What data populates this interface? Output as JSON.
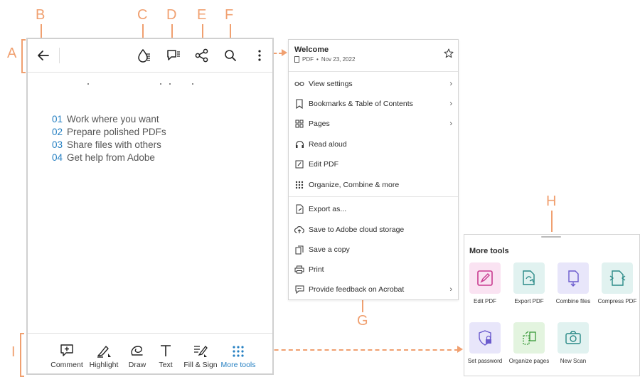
{
  "callouts": [
    "A",
    "B",
    "C",
    "D",
    "E",
    "F",
    "G",
    "H",
    "I"
  ],
  "toc": [
    {
      "num": "01",
      "text": "Work where you want"
    },
    {
      "num": "02",
      "text": "Prepare polished PDFs"
    },
    {
      "num": "03",
      "text": "Share files with others"
    },
    {
      "num": "04",
      "text": "Get help from Adobe"
    }
  ],
  "bottombar": [
    "Comment",
    "Highlight",
    "Draw",
    "Text",
    "Fill & Sign",
    "More tools"
  ],
  "menu": {
    "title": "Welcome",
    "meta_type": "PDF",
    "meta_dot": "•",
    "meta_date": "Nov 23, 2022",
    "items": [
      "View settings",
      "Bookmarks & Table of Contents",
      "Pages",
      "Read aloud",
      "Edit PDF",
      "Organize, Combine & more",
      "Export as...",
      "Save to Adobe cloud storage",
      "Save a copy",
      "Print",
      "Provide feedback on Acrobat"
    ]
  },
  "tools": {
    "title": "More tools",
    "items": [
      "Edit PDF",
      "Export PDF",
      "Combine files",
      "Compress PDF",
      "Set password",
      "Organize pages",
      "New Scan"
    ]
  },
  "colors": {
    "callout": "#f0a070",
    "accent": "#2680c2"
  }
}
